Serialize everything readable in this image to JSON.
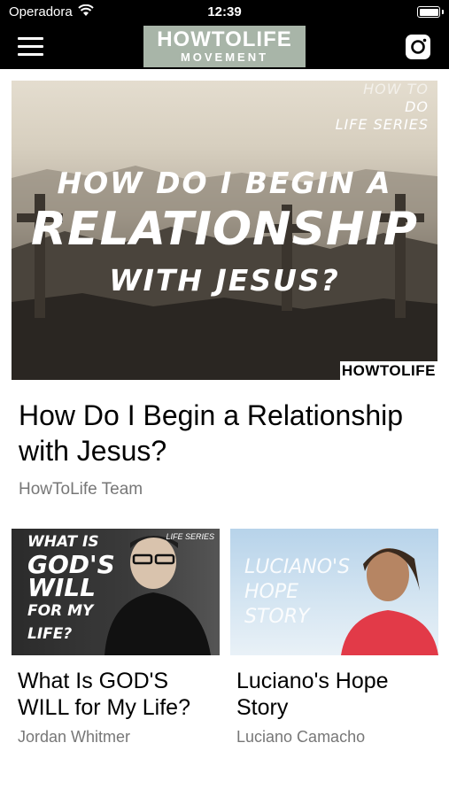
{
  "status_bar": {
    "carrier": "Operadora",
    "time": "12:39"
  },
  "nav": {
    "logo_top": "HOWTOLIFE",
    "logo_bottom": "MOVEMENT"
  },
  "featured": {
    "series_tag_1": "HOW TO",
    "series_tag_2": "DO",
    "series_tag_3": "LIFE SERIES",
    "image_line1": "HOW DO I BEGIN A",
    "image_line2": "RELATIONSHIP",
    "image_line3": "WITH JESUS?",
    "image_brand": "HOWTOLIFE",
    "title": "How Do I Begin a Relationship with Jesus?",
    "author": "HowToLife Team"
  },
  "cards": [
    {
      "thumb_lines": [
        "WHAT IS",
        "GOD'S",
        "WILL",
        "FOR MY",
        "LIFE?"
      ],
      "thumb_series": "LIFE SERIES",
      "title": "What Is GOD'S WILL for My Life?",
      "author": "Jordan Whitmer"
    },
    {
      "thumb_lines": [
        "LUCIANO'S",
        "HOPE",
        "STORY"
      ],
      "title": "Luciano's Hope Story",
      "author": "Luciano Camacho"
    }
  ]
}
